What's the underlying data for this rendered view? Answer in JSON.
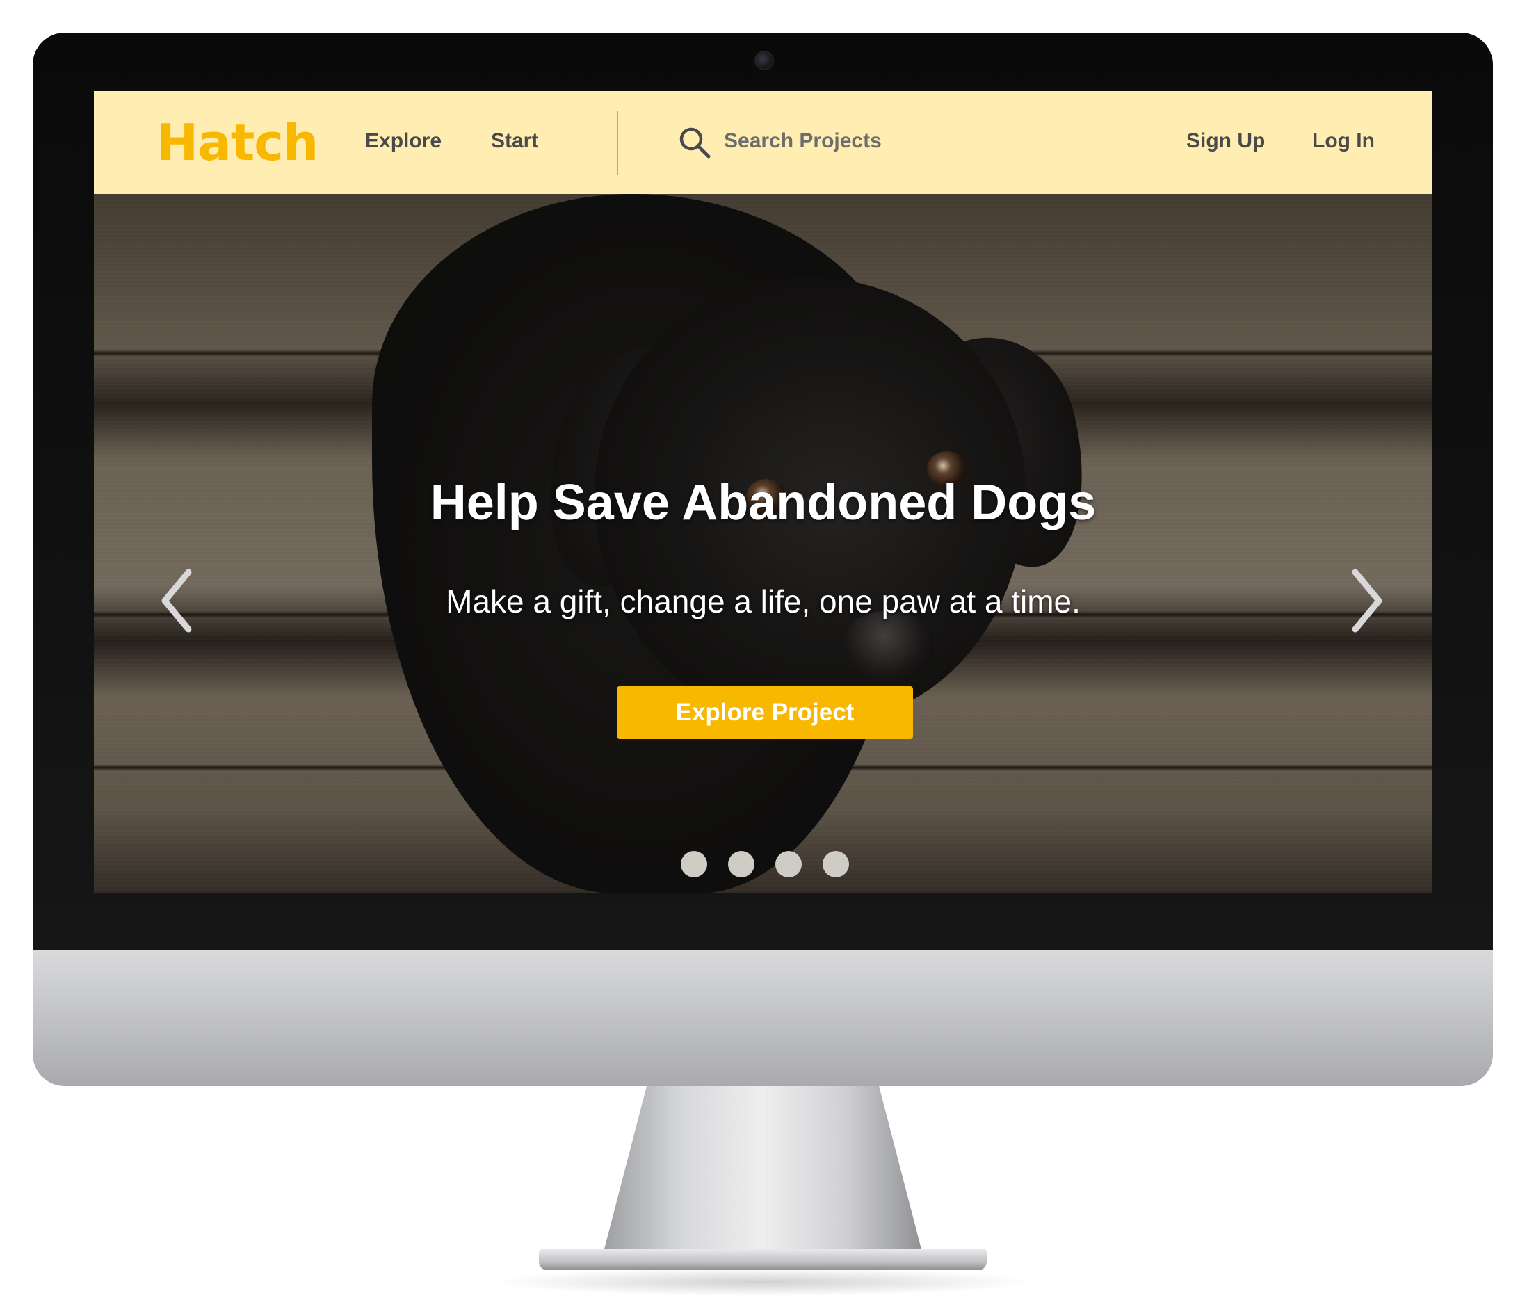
{
  "site": {
    "logo": "Hatch",
    "brand_color": "#f8b800",
    "navbar_color": "#ffedb2"
  },
  "nav": {
    "explore_label": "Explore",
    "start_label": "Start",
    "search_placeholder": "Search Projects",
    "search_icon": "search-icon",
    "sign_up_label": "Sign Up",
    "log_in_label": "Log In"
  },
  "hero": {
    "title": "Help Save Abandoned Dogs",
    "subtitle": "Make a gift, change a life, one paw at a time.",
    "cta_label": "Explore Project",
    "prev_icon": "chevron-left-icon",
    "next_icon": "chevron-right-icon",
    "slide_count": 4
  }
}
